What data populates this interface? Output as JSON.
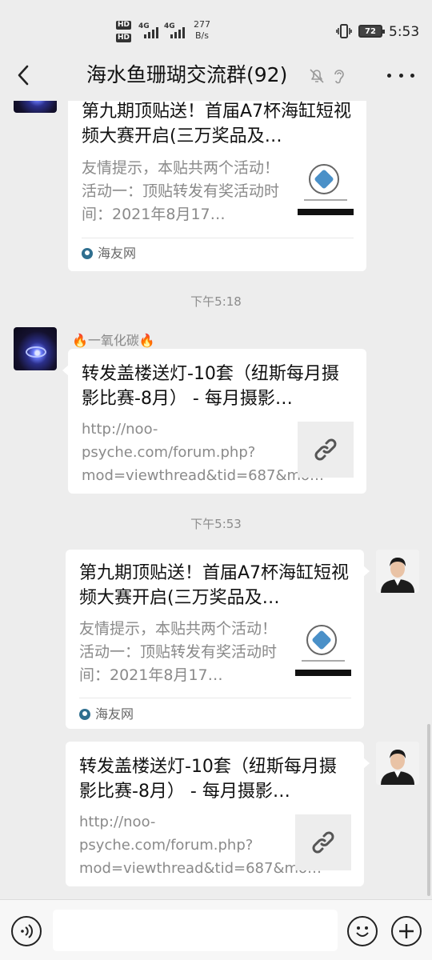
{
  "status_bar": {
    "network_top": "4G",
    "network_bottom": "4G",
    "hd": "HD",
    "speed_value": "277",
    "speed_unit": "B/s",
    "battery": "72",
    "time": "5:53"
  },
  "header": {
    "title": "海水鱼珊瑚交流群(92)"
  },
  "messages": [
    {
      "type": "card",
      "title": "第九期顶贴送！首届A7杯海缸短视频大赛开启(三万奖品及…",
      "desc": "友情提示，本贴共两个活动！活动一：顶贴转发有奖活动时间：2021年8月17…",
      "source": "海友网"
    },
    {
      "type": "time",
      "time": "下午5:18"
    },
    {
      "type": "link",
      "sender": "🔥一氧化碳🔥",
      "title": "转发盖楼送灯-10套（纽斯每月摄影比赛-8月） - 每月摄影…",
      "desc": "http://noo-psyche.com/forum.php?mod=viewthread&tid=687&mo…"
    },
    {
      "type": "time",
      "time": "下午5:53"
    },
    {
      "type": "card",
      "title": "第九期顶贴送！首届A7杯海缸短视频大赛开启(三万奖品及…",
      "desc": "友情提示，本贴共两个活动！活动一：顶贴转发有奖活动时间：2021年8月17…",
      "source": "海友网"
    },
    {
      "type": "link",
      "title": "转发盖楼送灯-10套（纽斯每月摄影比赛-8月） - 每月摄影…",
      "desc": "http://noo-psyche.com/forum.php?mod=viewthread&tid=687&mo…"
    }
  ],
  "input": {
    "value": ""
  },
  "icons": {
    "back": "chevron-left-icon",
    "mute": "bell-off-icon",
    "earpiece": "ear-icon",
    "more": "more-icon",
    "voice": "voice-icon",
    "emoji": "emoji-icon",
    "plus": "plus-icon",
    "link": "link-icon"
  }
}
